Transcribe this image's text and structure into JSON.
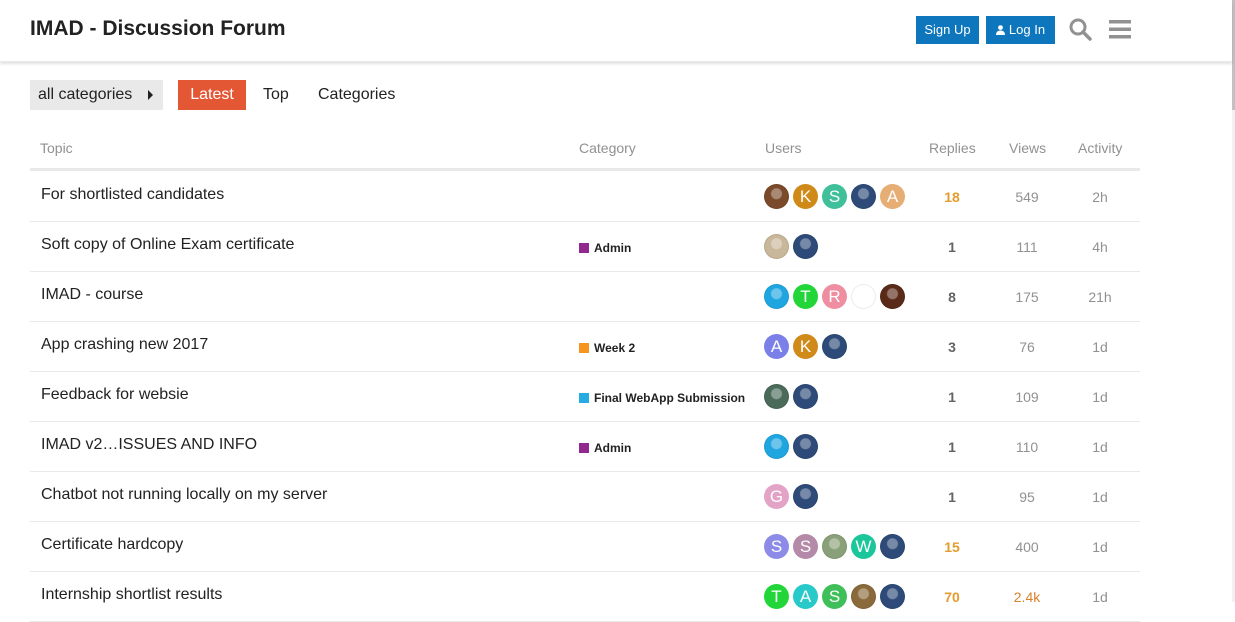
{
  "header": {
    "title": "IMAD - Discussion Forum",
    "signup_label": "Sign Up",
    "login_label": "Log In",
    "brand_color": "#0e76bd"
  },
  "nav": {
    "category_dropdown": "all categories",
    "tabs": [
      {
        "label": "Latest",
        "active": true
      },
      {
        "label": "Top",
        "active": false
      },
      {
        "label": "Categories",
        "active": false
      }
    ],
    "active_color": "#e45735"
  },
  "table": {
    "columns": [
      "Topic",
      "Category",
      "Users",
      "Replies",
      "Views",
      "Activity"
    ],
    "rows": [
      {
        "title": "For shortlisted candidates",
        "category": "",
        "category_color": "",
        "replies": "18",
        "views": "549",
        "activity": "2h",
        "users": [
          {
            "letter": "",
            "color": "#7a4a2a"
          },
          {
            "letter": "K",
            "color": "#d08a1a"
          },
          {
            "letter": "S",
            "color": "#3fbf9a"
          },
          {
            "letter": "",
            "color": "#2d4a78"
          },
          {
            "letter": "A",
            "color": "#e6ad74"
          }
        ]
      },
      {
        "title": "Soft copy of Online Exam certificate",
        "category": "Admin",
        "category_color": "#92278f",
        "replies": "1",
        "views": "111",
        "activity": "4h",
        "users": [
          {
            "letter": "",
            "color": "#c9b79a"
          },
          {
            "letter": "",
            "color": "#2d4a78"
          }
        ]
      },
      {
        "title": "IMAD - course",
        "category": "",
        "category_color": "",
        "replies": "8",
        "views": "175",
        "activity": "21h",
        "users": [
          {
            "letter": "",
            "color": "#1fa6e0"
          },
          {
            "letter": "T",
            "color": "#22d63a"
          },
          {
            "letter": "R",
            "color": "#ee8ea0"
          },
          {
            "letter": "",
            "color": "#ffffff"
          },
          {
            "letter": "",
            "color": "#5a2a18"
          }
        ]
      },
      {
        "title": "App crashing new 2017",
        "category": "Week 2",
        "category_color": "#f7941d",
        "replies": "3",
        "views": "76",
        "activity": "1d",
        "users": [
          {
            "letter": "A",
            "color": "#7b7fe8"
          },
          {
            "letter": "K",
            "color": "#d08a1a"
          },
          {
            "letter": "",
            "color": "#2d4a78"
          }
        ]
      },
      {
        "title": "Feedback for websie",
        "category": "Final WebApp Submission",
        "category_color": "#25aae1",
        "replies": "1",
        "views": "109",
        "activity": "1d",
        "users": [
          {
            "letter": "",
            "color": "#4a6a5a"
          },
          {
            "letter": "",
            "color": "#2d4a78"
          }
        ]
      },
      {
        "title": "IMAD v2…ISSUES AND INFO",
        "category": "Admin",
        "category_color": "#92278f",
        "replies": "1",
        "views": "110",
        "activity": "1d",
        "users": [
          {
            "letter": "",
            "color": "#1fa6e0"
          },
          {
            "letter": "",
            "color": "#2d4a78"
          }
        ]
      },
      {
        "title": "Chatbot not running locally on my server",
        "category": "",
        "category_color": "",
        "replies": "1",
        "views": "95",
        "activity": "1d",
        "users": [
          {
            "letter": "G",
            "color": "#e2a3c7"
          },
          {
            "letter": "",
            "color": "#2d4a78"
          }
        ]
      },
      {
        "title": "Certificate hardcopy",
        "category": "",
        "category_color": "",
        "replies": "15",
        "views": "400",
        "activity": "1d",
        "users": [
          {
            "letter": "S",
            "color": "#8c8ce8"
          },
          {
            "letter": "S",
            "color": "#b48aa8"
          },
          {
            "letter": "",
            "color": "#8aa078"
          },
          {
            "letter": "W",
            "color": "#1bc79a"
          },
          {
            "letter": "",
            "color": "#2d4a78"
          }
        ]
      },
      {
        "title": "Internship shortlist results",
        "category": "",
        "category_color": "",
        "replies": "70",
        "views": "2.4k",
        "activity": "1d",
        "users": [
          {
            "letter": "T",
            "color": "#22d63a"
          },
          {
            "letter": "A",
            "color": "#27c9c9"
          },
          {
            "letter": "S",
            "color": "#3fbf5a"
          },
          {
            "letter": "",
            "color": "#8a6a3a"
          },
          {
            "letter": "",
            "color": "#2d4a78"
          }
        ]
      }
    ]
  }
}
